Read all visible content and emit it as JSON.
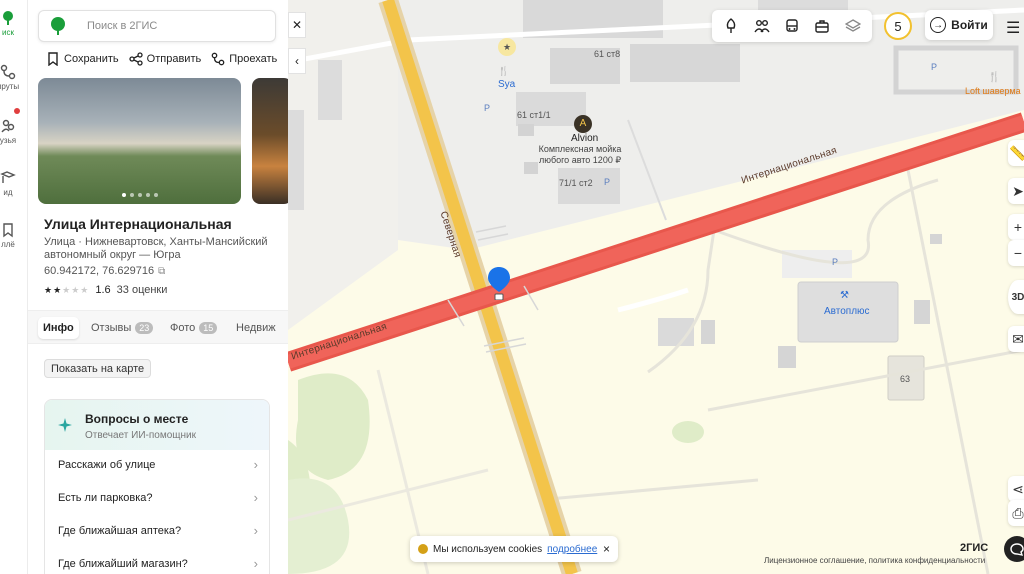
{
  "rail": {
    "items": [
      {
        "label": "иск",
        "icon": "search-icon",
        "active": true
      },
      {
        "label": "ируты",
        "icon": "routes-icon"
      },
      {
        "label": "узья",
        "icon": "friends-icon"
      },
      {
        "label": "ид",
        "icon": "guide-icon"
      },
      {
        "label": "ллё",
        "icon": "collections-icon"
      }
    ]
  },
  "search": {
    "placeholder": "Поиск в 2ГИС",
    "value": ""
  },
  "actions": {
    "save": "Сохранить",
    "send": "Отправить",
    "route": "Проехать"
  },
  "place": {
    "title": "Улица Интернациональная",
    "subtitle": "Улица · Нижневартовск, Ханты-Мансийский автономный округ — Югра",
    "coords": "60.942172, 76.629716",
    "rating": "1.6",
    "rating_count": "33 оценки"
  },
  "tabs": [
    {
      "label": "Инфо",
      "active": true
    },
    {
      "label": "Отзывы",
      "badge": "23"
    },
    {
      "label": "Фото",
      "badge": "15"
    },
    {
      "label": "Недвиж"
    }
  ],
  "show_map": "Показать на карте",
  "questions": {
    "title": "Вопросы о месте",
    "subtitle": "Отвечает ИИ-помощник",
    "items": [
      "Расскажи об улице",
      "Есть ли парковка?",
      "Где ближайшая аптека?",
      "Где ближайший магазин?"
    ]
  },
  "map": {
    "labels": {
      "b1": "61 ст8",
      "b2": "61 ст1/1",
      "b3": "71/1 ст2",
      "b4": "63",
      "sya": "Sya",
      "alvion": "Alvion",
      "alvion_desc": "Комплексная мойка любого авто 1200 ₽",
      "avtoplus": "Автоплюс",
      "loft": "Loft шаверма",
      "street_main": "Интернациональная",
      "street_main2": "Интернациональная",
      "street_cross": "Северная",
      "p": "P"
    },
    "counter": "5",
    "login": "Войти",
    "zoom_in": "+",
    "zoom_out": "−",
    "mode3d": "3D",
    "cookie": {
      "text": "Мы используем cookies",
      "link": "подробнее"
    },
    "brand": "2ГИС",
    "license": "Лицензионное соглашение, политика конфиденциальности"
  },
  "colors": {
    "main_road": "#f0645a",
    "cross_road": "#f3c44a",
    "accent": "#1a9e3a",
    "pin": "#1a73e8"
  }
}
